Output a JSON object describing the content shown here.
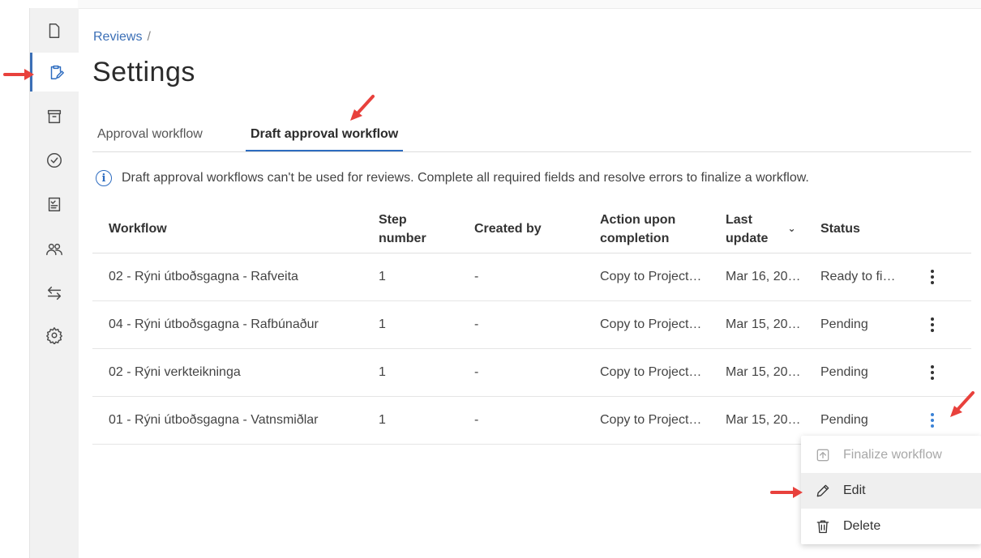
{
  "sidebar": {
    "items": [
      {
        "icon": "document-icon"
      },
      {
        "icon": "clipboard-edit-icon",
        "active": true
      },
      {
        "icon": "archive-icon"
      },
      {
        "icon": "check-circle-icon"
      },
      {
        "icon": "checklist-icon"
      },
      {
        "icon": "people-icon"
      },
      {
        "icon": "transfer-arrows-icon"
      },
      {
        "icon": "gear-icon"
      }
    ]
  },
  "header": {
    "breadcrumb": "Reviews",
    "breadcrumb_separator": "/",
    "title": "Settings"
  },
  "tabs": [
    {
      "label": "Approval workflow"
    },
    {
      "label": "Draft approval workflow",
      "active": true
    }
  ],
  "info": {
    "icon": "info-icon",
    "text": "Draft approval workflows can't be used for reviews. Complete all required fields and resolve errors to finalize a workflow."
  },
  "table": {
    "headers": {
      "workflow": "Workflow",
      "step_line1": "Step",
      "step_line2": "number",
      "created_by": "Created by",
      "action_line1": "Action upon",
      "action_line2": "completion",
      "last_line1": "Last",
      "last_line2": "update",
      "status": "Status"
    },
    "rows": [
      {
        "workflow": "02 - Rýni útboðsgagna - Rafveita",
        "step": "1",
        "created_by": "-",
        "action": "Copy to Project…",
        "updated": "Mar 16, 20…",
        "status": "Ready to fi…"
      },
      {
        "workflow": "04 - Rýni útboðsgagna - Rafbúnaður",
        "step": "1",
        "created_by": "-",
        "action": "Copy to Project…",
        "updated": "Mar 15, 20…",
        "status": "Pending"
      },
      {
        "workflow": "02 - Rýni verkteikninga",
        "step": "1",
        "created_by": "-",
        "action": "Copy to Project…",
        "updated": "Mar 15, 20…",
        "status": "Pending"
      },
      {
        "workflow": "01 - Rýni útboðsgagna - Vatnsmiðlar",
        "step": "1",
        "created_by": "-",
        "action": "Copy to Project…",
        "updated": "Mar 15, 20…",
        "status": "Pending"
      }
    ]
  },
  "menu": {
    "items": [
      {
        "label": "Finalize workflow",
        "icon": "finalize-upload-icon",
        "disabled": true
      },
      {
        "label": "Edit",
        "icon": "pencil-icon"
      },
      {
        "label": "Delete",
        "icon": "trash-icon"
      }
    ]
  },
  "colors": {
    "accent": "#2d6cc0",
    "annotation_arrow": "#e8413c",
    "sidebar_bg": "#f1f1f1"
  }
}
